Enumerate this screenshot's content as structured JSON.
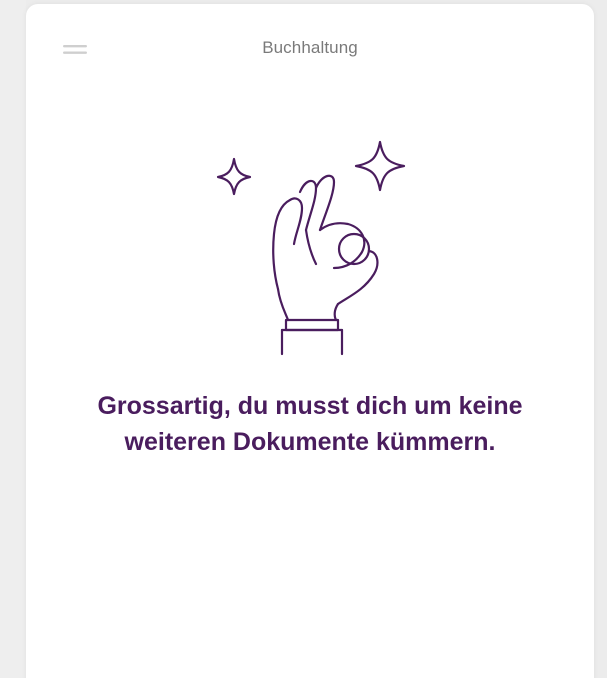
{
  "header": {
    "title": "Buchhaltung",
    "menu_icon": "hamburger-menu-icon"
  },
  "empty_state": {
    "illustration_icon": "ok-hand-sparkles-icon",
    "message_line_1": "Grossartig, du musst dich um keine",
    "message_line_2": "weiteren Dokumente kümmern."
  },
  "colors": {
    "accent": "#4a1d5e",
    "header_text": "#7a7a7a",
    "card_background": "#ffffff",
    "page_background": "#ececec"
  }
}
